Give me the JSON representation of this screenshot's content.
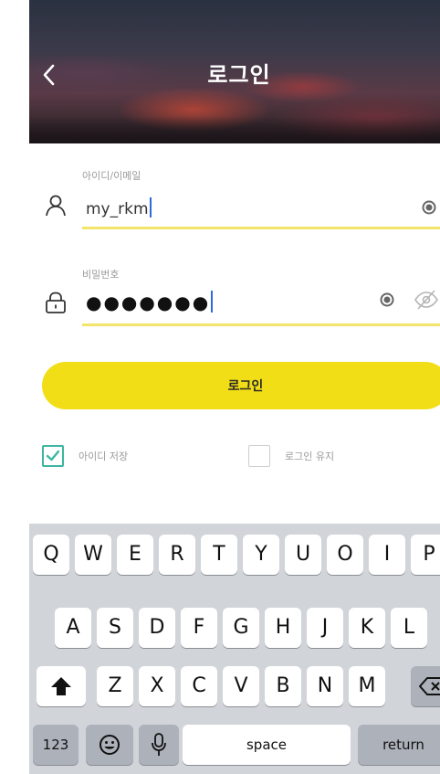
{
  "header": {
    "title": "로그인",
    "back_icon": "chevron-left-icon"
  },
  "form": {
    "id_field": {
      "label": "아이디/이메일",
      "value": "my_rkm",
      "icon": "user-icon",
      "clear_icon": "clear-icon"
    },
    "password_field": {
      "label": "비밀번호",
      "value_masked": "●●●●●●●",
      "icon": "lock-icon",
      "clear_icon": "clear-icon",
      "visibility_icon": "eye-off-icon"
    },
    "login_button_label": "로그인",
    "save_id": {
      "label": "아이디 저장",
      "checked": true
    },
    "stay_logged_in": {
      "label": "로그인 유지",
      "checked": false
    }
  },
  "keyboard": {
    "row1": [
      "Q",
      "W",
      "E",
      "R",
      "T",
      "Y",
      "U",
      "O",
      "I",
      "P"
    ],
    "row2": [
      "A",
      "S",
      "D",
      "F",
      "G",
      "H",
      "J",
      "K",
      "L"
    ],
    "row3": [
      "Z",
      "X",
      "C",
      "V",
      "B",
      "N",
      "M"
    ],
    "numbers_key": "123",
    "space_key": "space",
    "return_key": "return",
    "shift_icon": "shift-icon",
    "backspace_icon": "backspace-icon",
    "emoji_icon": "emoji-icon",
    "mic_icon": "microphone-icon"
  },
  "colors": {
    "accent_yellow": "#f2de16",
    "underline_yellow": "#f3e46a",
    "checkbox_green": "#3cb6a0",
    "caret_blue": "#2a6be0"
  }
}
